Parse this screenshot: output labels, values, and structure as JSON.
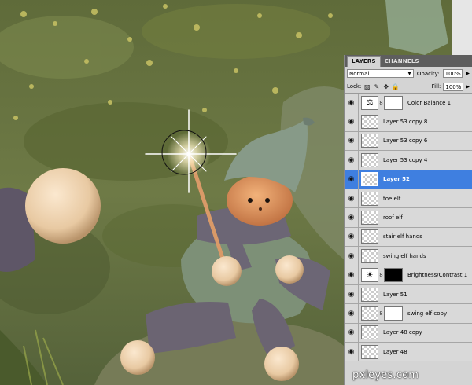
{
  "panel": {
    "tabs": [
      "LAYERS",
      "CHANNELS"
    ],
    "blend_mode": "Normal",
    "opacity_label": "Opacity:",
    "opacity_value": "100%",
    "lock_label": "Lock:",
    "fill_label": "Fill:",
    "fill_value": "100%",
    "layers": [
      {
        "name": "Color Balance 1",
        "thumb": "balance-icon",
        "mask": "white",
        "selected": false
      },
      {
        "name": "Layer 53 copy 8",
        "thumb": "transparent",
        "selected": false
      },
      {
        "name": "Layer 53 copy 6",
        "thumb": "transparent",
        "selected": false
      },
      {
        "name": "Layer 53 copy 4",
        "thumb": "transparent",
        "selected": false
      },
      {
        "name": "Layer 52",
        "thumb": "transparent",
        "selected": true
      },
      {
        "name": "toe elf",
        "thumb": "transparent",
        "selected": false
      },
      {
        "name": "roof elf",
        "thumb": "transparent",
        "selected": false
      },
      {
        "name": "stair elf hands",
        "thumb": "transparent",
        "selected": false
      },
      {
        "name": "swing elf hands",
        "thumb": "transparent",
        "selected": false
      },
      {
        "name": "Brightness/Contrast 1",
        "thumb": "sun-icon",
        "mask": "black",
        "selected": false
      },
      {
        "name": "Layer 51",
        "thumb": "transparent",
        "selected": false
      },
      {
        "name": "swing elf copy",
        "thumb": "transparent",
        "mask": "white",
        "selected": false
      },
      {
        "name": "Layer 48 copy",
        "thumb": "transparent",
        "selected": false
      },
      {
        "name": "Layer 48",
        "thumb": "transparent",
        "selected": false
      }
    ]
  },
  "watermark": "pxleyes.com",
  "colors": {
    "selection": "#3f7fe0",
    "panel_bg": "#d4d4d4",
    "tab_bar": "#5e5e5e"
  }
}
